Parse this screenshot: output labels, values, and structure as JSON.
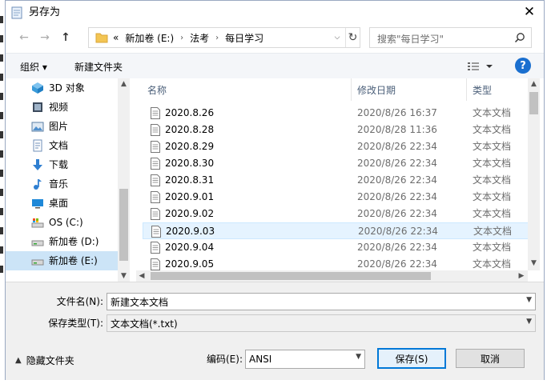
{
  "window": {
    "title": "另存为",
    "close_glyph": "✕"
  },
  "nav_buttons": {
    "back": "←",
    "forward": "→",
    "up": "↑"
  },
  "address": {
    "overflow": "«",
    "crumbs": [
      "新加卷 (E:)",
      "法考",
      "每日学习"
    ],
    "separator": "›",
    "dropdown": "⌵",
    "refresh": "↻"
  },
  "search": {
    "placeholder": "搜索\"每日学习\""
  },
  "toolbar": {
    "organize": "组织 ▾",
    "new_folder": "新建文件夹",
    "help": "?"
  },
  "nav_pane": {
    "items": [
      {
        "label": "3D 对象",
        "icon": "3d-objects-icon"
      },
      {
        "label": "视频",
        "icon": "video-icon"
      },
      {
        "label": "图片",
        "icon": "pictures-icon"
      },
      {
        "label": "文档",
        "icon": "documents-icon"
      },
      {
        "label": "下载",
        "icon": "download-icon"
      },
      {
        "label": "音乐",
        "icon": "music-icon"
      },
      {
        "label": "桌面",
        "icon": "desktop-icon"
      },
      {
        "label": "OS (C:)",
        "icon": "drive-c-icon"
      },
      {
        "label": "新加卷 (D:)",
        "icon": "drive-icon"
      },
      {
        "label": "新加卷 (E:)",
        "icon": "drive-icon",
        "selected": true
      }
    ]
  },
  "file_list": {
    "columns": {
      "name": "名称",
      "date": "修改日期",
      "type": "类型"
    },
    "sort_indicator": "^",
    "rows": [
      {
        "name": "2020.8.26",
        "date": "2020/8/26 16:37",
        "type": "文本文档"
      },
      {
        "name": "2020.8.28",
        "date": "2020/8/28 11:36",
        "type": "文本文档"
      },
      {
        "name": "2020.8.29",
        "date": "2020/8/26 22:34",
        "type": "文本文档"
      },
      {
        "name": "2020.8.30",
        "date": "2020/8/26 22:34",
        "type": "文本文档"
      },
      {
        "name": "2020.8.31",
        "date": "2020/8/26 22:34",
        "type": "文本文档"
      },
      {
        "name": "2020.9.01",
        "date": "2020/8/26 22:34",
        "type": "文本文档"
      },
      {
        "name": "2020.9.02",
        "date": "2020/8/26 22:34",
        "type": "文本文档"
      },
      {
        "name": "2020.9.03",
        "date": "2020/8/26 22:34",
        "type": "文本文档",
        "selected": true
      },
      {
        "name": "2020.9.04",
        "date": "2020/8/26 22:34",
        "type": "文本文档"
      },
      {
        "name": "2020.9.05",
        "date": "2020/8/26 22:34",
        "type": "文本文档"
      }
    ]
  },
  "form": {
    "filename_label": "文件名(N):",
    "filename_value": "新建文本文档",
    "savetype_label": "保存类型(T):",
    "savetype_value": "文本文档(*.txt)",
    "encoding_label": "编码(E):",
    "encoding_value": "ANSI",
    "hide_folders": "隐藏文件夹",
    "save_button": "保存(S)",
    "cancel_button": "取消"
  },
  "colors": {
    "accent": "#0078d7",
    "selection": "#cce4f7",
    "help": "#1a6fcf"
  }
}
